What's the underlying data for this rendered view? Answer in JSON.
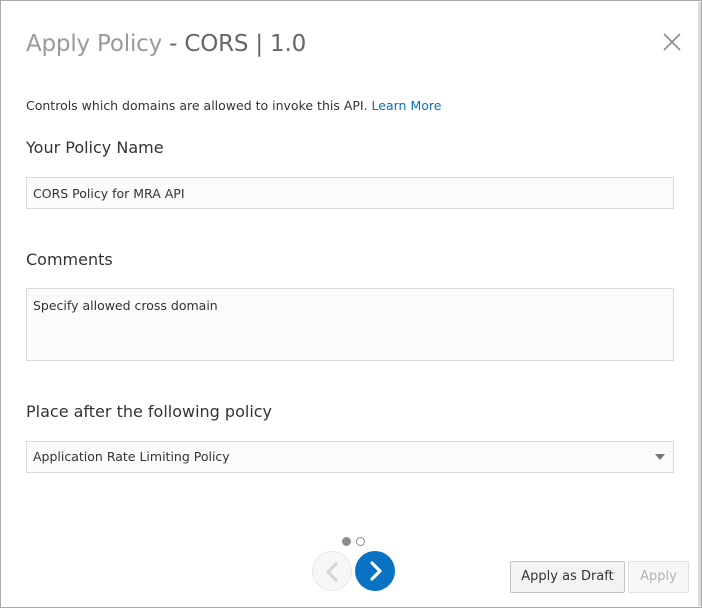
{
  "dialog": {
    "title": "Apply Policy",
    "title_separator": " - ",
    "subtitle": "CORS | 1.0",
    "close_icon": "close-icon"
  },
  "description": {
    "text": "Controls which domains are allowed to invoke this API. ",
    "link": "Learn More"
  },
  "policy_name": {
    "label": "Your Policy Name",
    "value": "CORS Policy for MRA API"
  },
  "comments": {
    "label": "Comments",
    "value": "Specify allowed cross domain"
  },
  "place_after": {
    "label": "Place after the following policy",
    "selected": "Application Rate Limiting Policy",
    "icon": "chevron-down-icon"
  },
  "pagination": {
    "current_page": 1,
    "total_pages": 2,
    "prev_icon": "chevron-left-icon",
    "next_icon": "chevron-right-icon"
  },
  "footer": {
    "apply_draft_label": "Apply as Draft",
    "apply_label": "Apply"
  },
  "colors": {
    "accent": "#0a72c2",
    "link": "#0c6fb8",
    "title": "#9a9a9a",
    "subtitle": "#666666",
    "disabled_text": "#b3b3b3"
  }
}
